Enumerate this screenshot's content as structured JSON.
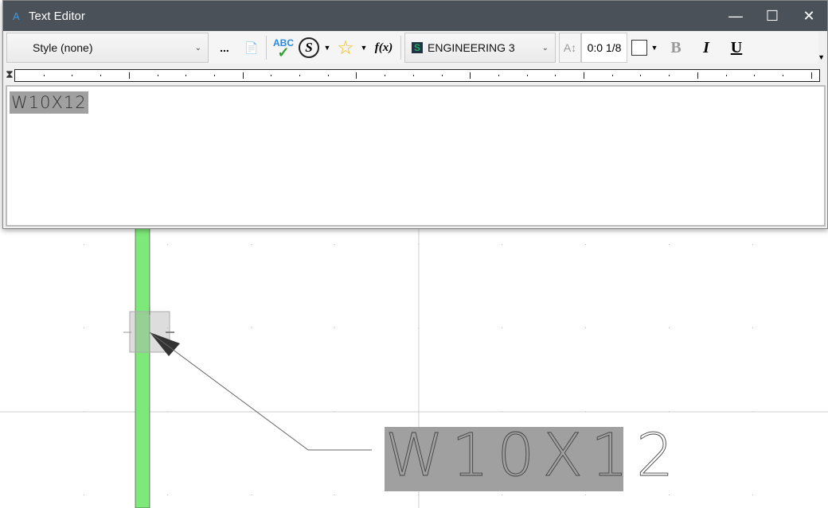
{
  "window": {
    "title": "Text Editor",
    "app_icon": "A"
  },
  "toolbar": {
    "style": "Style (none)",
    "more": "...",
    "font": "ENGINEERING 3",
    "text_height": "0:0 1/8",
    "bold": "B",
    "italic": "I",
    "underline": "U",
    "spell": "ABC",
    "symbol": "S",
    "fx": "f(x)"
  },
  "editor": {
    "text": "W10X12"
  },
  "drawing": {
    "label": "W10X12"
  },
  "colors": {
    "column": "#7ee87a",
    "titlebar": "#4a5158",
    "highlight": "#a0a0a0"
  }
}
